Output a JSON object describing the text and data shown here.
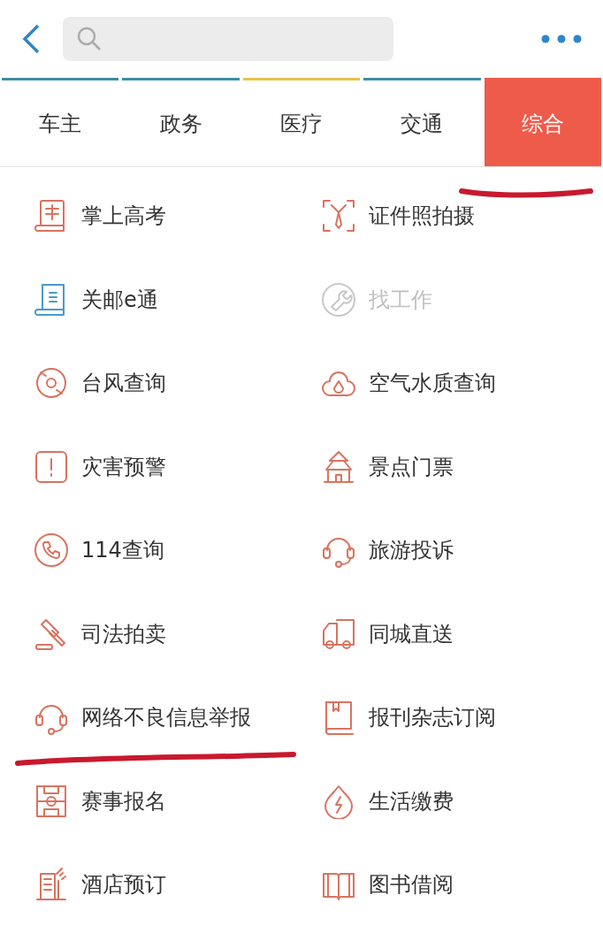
{
  "tabs": [
    {
      "label": "车主",
      "selected": false,
      "color": "#3a8fa0",
      "marked": false
    },
    {
      "label": "政务",
      "selected": false,
      "color": "#3a8fa0",
      "marked": false
    },
    {
      "label": "医疗",
      "selected": false,
      "color": "#e8c24a",
      "marked": false
    },
    {
      "label": "交通",
      "selected": false,
      "color": "#3a8fa0",
      "marked": false
    },
    {
      "label": "综合",
      "selected": true,
      "color": "#ee5b4b",
      "marked": true
    }
  ],
  "items": [
    {
      "label": "掌上高考",
      "kind": "ranking",
      "color": "#d9735f",
      "disabled": false,
      "marked": false
    },
    {
      "label": "证件照拍摄",
      "kind": "portrait",
      "color": "#d9735f",
      "disabled": false,
      "marked": false
    },
    {
      "label": "关邮e通",
      "kind": "scroll",
      "color": "#4a9ac8",
      "disabled": false,
      "marked": false
    },
    {
      "label": "找工作",
      "kind": "wrench",
      "color": "#c8c8c8",
      "disabled": true,
      "marked": false
    },
    {
      "label": "台风查询",
      "kind": "typhoon",
      "color": "#d9735f",
      "disabled": false,
      "marked": false
    },
    {
      "label": "空气水质查询",
      "kind": "cloud",
      "color": "#d9735f",
      "disabled": false,
      "marked": false
    },
    {
      "label": "灾害预警",
      "kind": "alert",
      "color": "#d9735f",
      "disabled": false,
      "marked": false
    },
    {
      "label": "景点门票",
      "kind": "temple",
      "color": "#d9735f",
      "disabled": false,
      "marked": false
    },
    {
      "label": "114查询",
      "kind": "phone",
      "color": "#d9735f",
      "disabled": false,
      "marked": false
    },
    {
      "label": "旅游投诉",
      "kind": "headset",
      "color": "#d9735f",
      "disabled": false,
      "marked": false
    },
    {
      "label": "司法拍卖",
      "kind": "gavel",
      "color": "#d9735f",
      "disabled": false,
      "marked": false
    },
    {
      "label": "同城直送",
      "kind": "truck",
      "color": "#d9735f",
      "disabled": false,
      "marked": false
    },
    {
      "label": "网络不良信息举报",
      "kind": "headset",
      "color": "#d9735f",
      "disabled": false,
      "marked": true
    },
    {
      "label": "报刊杂志订阅",
      "kind": "book",
      "color": "#d9735f",
      "disabled": false,
      "marked": false
    },
    {
      "label": "赛事报名",
      "kind": "field",
      "color": "#d9735f",
      "disabled": false,
      "marked": false
    },
    {
      "label": "生活缴费",
      "kind": "bolt",
      "color": "#d9735f",
      "disabled": false,
      "marked": false
    },
    {
      "label": "酒店预订",
      "kind": "hotel",
      "color": "#d9735f",
      "disabled": false,
      "marked": false
    },
    {
      "label": "图书借阅",
      "kind": "openbook",
      "color": "#d9735f",
      "disabled": false,
      "marked": false
    }
  ]
}
